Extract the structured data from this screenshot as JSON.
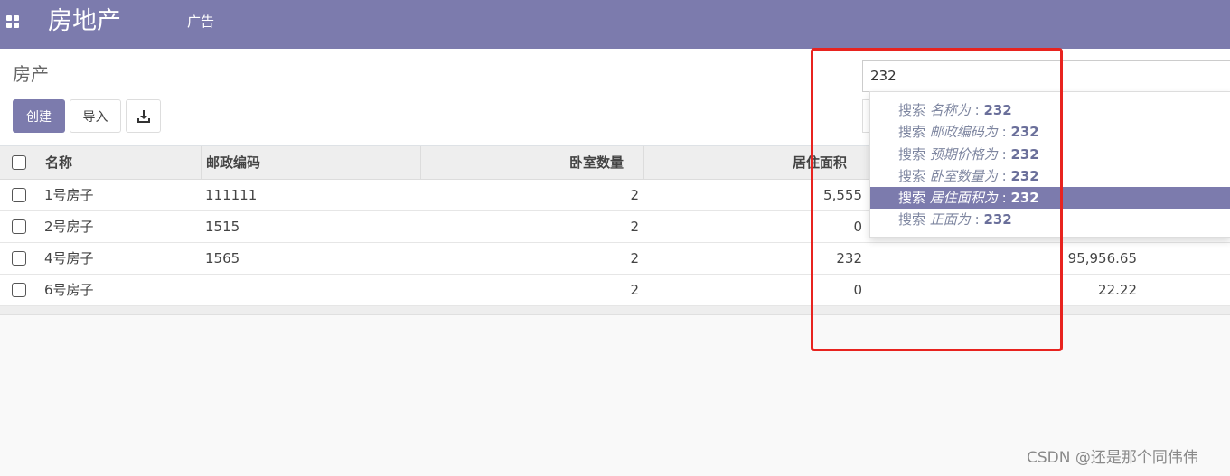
{
  "header": {
    "brand": "房地产",
    "nav_item": "广告"
  },
  "control": {
    "title": "房产",
    "create_label": "创建",
    "import_label": "导入",
    "download_icon": "download-icon"
  },
  "search": {
    "value": "232",
    "options": [
      {
        "prefix": "搜索",
        "field": "名称为",
        "sep": ":",
        "term": "232",
        "active": false
      },
      {
        "prefix": "搜索",
        "field": "邮政编码为",
        "sep": ":",
        "term": "232",
        "active": false
      },
      {
        "prefix": "搜索",
        "field": "预期价格为",
        "sep": ":",
        "term": "232",
        "active": false
      },
      {
        "prefix": "搜索",
        "field": "卧室数量为",
        "sep": ":",
        "term": "232",
        "active": false
      },
      {
        "prefix": "搜索",
        "field": "居住面积为",
        "sep": ":",
        "term": "232",
        "active": true
      },
      {
        "prefix": "搜索",
        "field": "正面为",
        "sep": ":",
        "term": "232",
        "active": false
      }
    ]
  },
  "table": {
    "columns": [
      "名称",
      "邮政编码",
      "卧室数量",
      "居住面积"
    ],
    "rows": [
      {
        "name": "1号房子",
        "zip": "111111",
        "bedrooms": "2",
        "area": "5,555",
        "extra": ""
      },
      {
        "name": "2号房子",
        "zip": "1515",
        "bedrooms": "2",
        "area": "0",
        "extra": ""
      },
      {
        "name": "4号房子",
        "zip": "1565",
        "bedrooms": "2",
        "area": "232",
        "extra": "95,956.65"
      },
      {
        "name": "6号房子",
        "zip": "",
        "bedrooms": "2",
        "area": "0",
        "extra": "22.22"
      }
    ]
  },
  "watermark": "CSDN @还是那个同伟伟",
  "colors": {
    "brand": "#7c7bad",
    "highlight": "#e8231f"
  }
}
